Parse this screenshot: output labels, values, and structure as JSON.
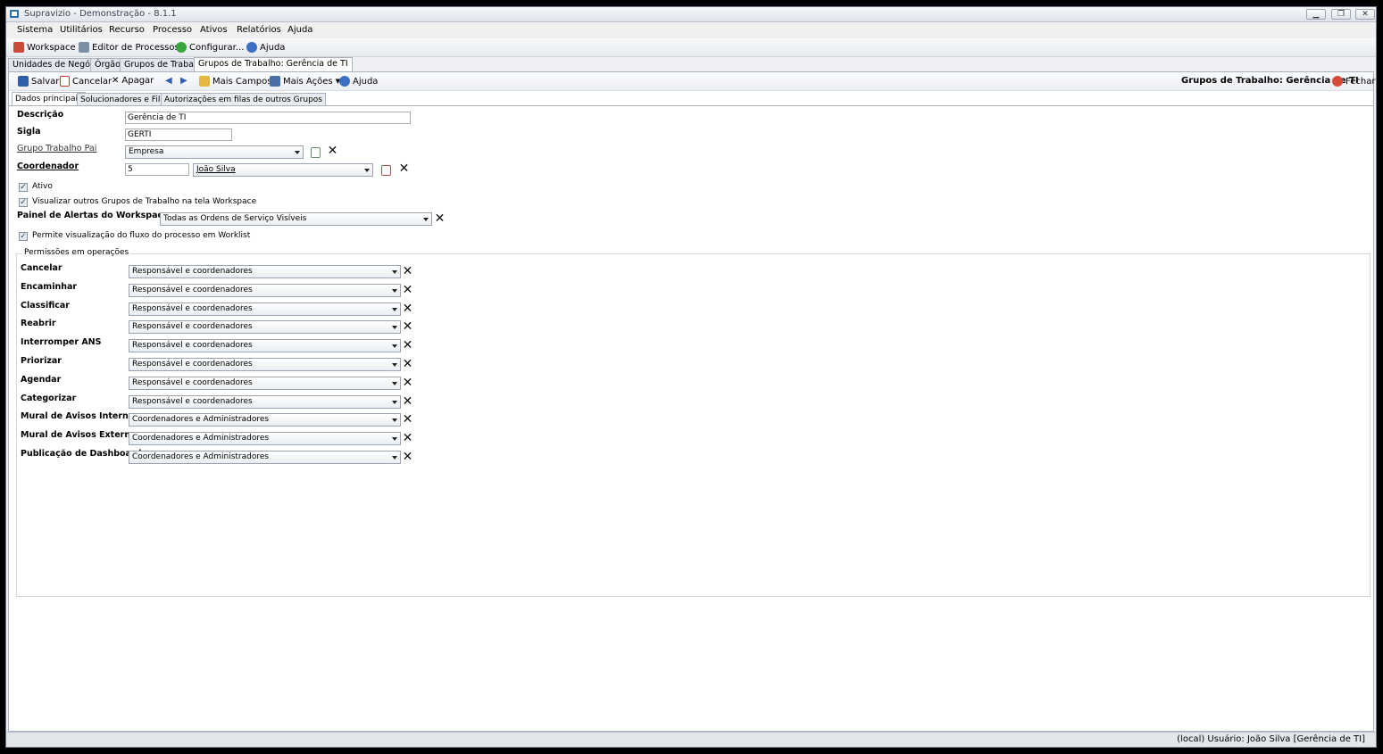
{
  "window": {
    "title": "Supravizio - Demonstração - 8.1.1"
  },
  "menu": [
    "Sistema",
    "Utilitários",
    "Recurso",
    "Processo",
    "Ativos",
    "Relatórios",
    "Ajuda"
  ],
  "toolbar": {
    "workspace": "Workspace",
    "editor": "Editor de Processos",
    "configurar": "Configurar...",
    "ajuda": "Ajuda"
  },
  "tabs": [
    "Unidades de Negócio",
    "Órgão",
    "Grupos de Trabalho",
    "Grupos de Trabalho: Gerência de TI"
  ],
  "actions": {
    "salvar": "Salvar",
    "cancelar": "Cancelar",
    "apagar": "Apagar",
    "mais_campos": "Mais Campos",
    "mais_acoes": "Mais Ações",
    "ajuda": "Ajuda",
    "header_title": "Grupos de Trabalho: Gerência de TI",
    "fechar": "Fechar"
  },
  "subtabs": [
    "Dados principais",
    "Solucionadores e Filas",
    "Autorizações em filas de outros Grupos"
  ],
  "form": {
    "descricao_label": "Descrição",
    "descricao_value": "Gerência de TI",
    "sigla_label": "Sigla",
    "sigla_value": "GERTI",
    "grupo_pai_label": "Grupo Trabalho Pai",
    "grupo_pai_value": "Empresa",
    "coordenador_label": "Coordenador",
    "coordenador_id": "5",
    "coordenador_nome": "João Silva",
    "ativo_label": "Ativo",
    "visualizar_label": "Visualizar outros Grupos de Trabalho na tela Workspace",
    "painel_label": "Painel de Alertas do Workspace",
    "painel_value": "Todas as Ordens de Serviço Visíveis",
    "permite_label": "Permite visualização do fluxo do processo em Worklist"
  },
  "permissions": {
    "title": "Permissões em operações",
    "items": [
      {
        "label": "Cancelar",
        "value": "Responsável e coordenadores"
      },
      {
        "label": "Encaminhar",
        "value": "Responsável e coordenadores"
      },
      {
        "label": "Classificar",
        "value": "Responsável e coordenadores"
      },
      {
        "label": "Reabrir",
        "value": "Responsável e coordenadores"
      },
      {
        "label": "Interromper ANS",
        "value": "Responsável e coordenadores"
      },
      {
        "label": "Priorizar",
        "value": "Responsável e coordenadores"
      },
      {
        "label": "Agendar",
        "value": "Responsável e coordenadores"
      },
      {
        "label": "Categorizar",
        "value": "Responsável e coordenadores"
      },
      {
        "label": "Mural de Avisos Interno",
        "value": "Coordenadores e Administradores"
      },
      {
        "label": "Mural de Avisos Externo",
        "value": "Coordenadores e Administradores"
      },
      {
        "label": "Publicação de Dashboard",
        "value": "Coordenadores e Administradores"
      }
    ]
  },
  "status": {
    "text": "(local)  Usuário: João Silva [Gerência de TI]"
  }
}
